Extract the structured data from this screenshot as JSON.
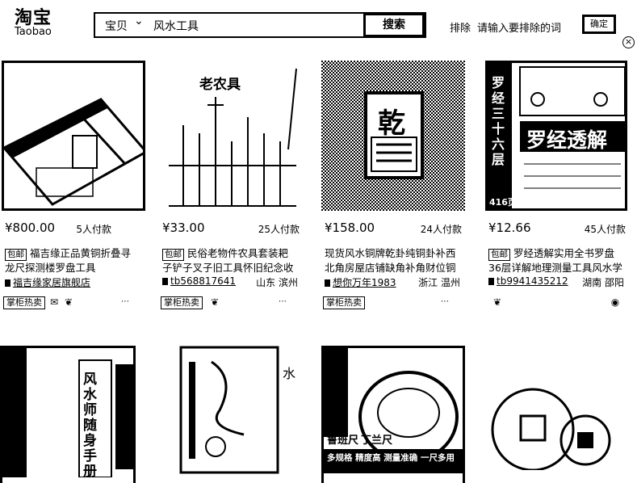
{
  "header": {
    "logo_cn": "淘宝",
    "logo_en": "Taobao",
    "search_scope": "宝贝",
    "search_query": "风水工具",
    "search_button": "搜索",
    "exclude_label": "排除",
    "exclude_placeholder": "请输入要排除的词",
    "confirm_button": "确定"
  },
  "products": [
    {
      "price": "¥800.00",
      "pay_count": "5人付款",
      "baoyou": "包邮",
      "title_line1": "福吉缘正品黄铜折叠寻",
      "title_line2": "龙尺探测楼罗盘工具",
      "shop": "福吉缘家居旗舰店",
      "location": "",
      "badge": "掌柜热卖"
    },
    {
      "price": "¥33.00",
      "pay_count": "25人付款",
      "baoyou": "包邮",
      "title_line1": "民俗老物件农具套装耙",
      "title_line2": "子铲子叉子旧工具怀旧纪念收",
      "shop": "tb568817641",
      "location": "山东 滨州",
      "badge": "掌柜热卖",
      "image_text": "老农具"
    },
    {
      "price": "¥158.00",
      "pay_count": "24人付款",
      "baoyou": "",
      "title_line1": "现货风水铜牌乾卦纯铜卦补西",
      "title_line2": "北角房屋店铺缺角补角财位铜",
      "shop": "想你万年1983",
      "location": "浙江 温州",
      "badge": "掌柜热卖",
      "image_text": "乾"
    },
    {
      "price": "¥12.66",
      "pay_count": "45人付款",
      "baoyou": "包邮",
      "title_line1": "罗经透解实用全书罗盘",
      "title_line2": "36层详解地理测量工具风水学",
      "shop": "tb9941435212",
      "location": "湖南 邵阳",
      "badge": "",
      "image_text_main": "罗经透解",
      "image_text_side": "罗经三十六层",
      "image_text_price": "416页"
    }
  ],
  "row2": {
    "p5_text": "风水师随身手册",
    "p7_text": "鲁班尺",
    "p7_sub": "丁兰尺",
    "p7_bottom": "多规格 精度高 测量准确 一尺多用"
  }
}
